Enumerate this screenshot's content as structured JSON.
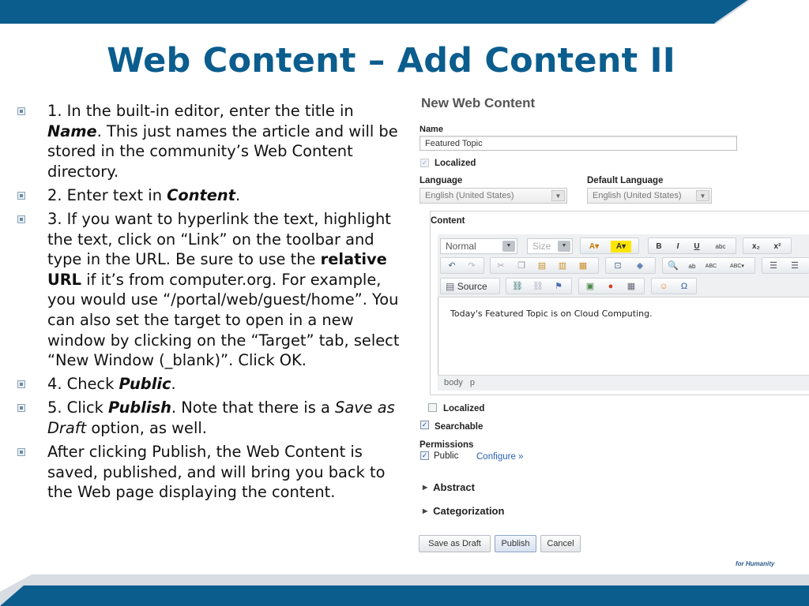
{
  "slide": {
    "title": "Web Content – Add Content II",
    "bullets": [
      {
        "runs": [
          {
            "t": "1. In the built-in editor, enter the title in "
          },
          {
            "t": "Name",
            "s": "bi"
          },
          {
            "t": ". This just names the article and will be stored in the community’s Web Content directory."
          }
        ]
      },
      {
        "runs": [
          {
            "t": "2. Enter text in "
          },
          {
            "t": "Content",
            "s": "bi"
          },
          {
            "t": "."
          }
        ]
      },
      {
        "runs": [
          {
            "t": "3. If you want to hyperlink the text, highlight the text, click on “Link” on the toolbar and type in the URL. Be sure to use the "
          },
          {
            "t": "relative URL",
            "s": "b"
          },
          {
            "t": " if it’s from computer.org. For example, you would use “/portal/web/guest/home”. You can also set the target to open in a new window by clicking on the “Target” tab, select “New Window (_blank)”. Click OK."
          }
        ]
      },
      {
        "runs": [
          {
            "t": "4. Check "
          },
          {
            "t": "Public",
            "s": "bi"
          },
          {
            "t": "."
          }
        ]
      },
      {
        "runs": [
          {
            "t": "5. Click "
          },
          {
            "t": "Publish",
            "s": "bi"
          },
          {
            "t": ". Note that there is a "
          },
          {
            "t": "Save as Draft",
            "s": "i"
          },
          {
            "t": " option, as well."
          }
        ]
      },
      {
        "runs": [
          {
            "t": "After clicking Publish, the Web Content is saved, published, and will bring you back to the Web page displaying the content."
          }
        ]
      }
    ]
  },
  "form": {
    "heading": "New Web Content",
    "name_label": "Name",
    "name_value": "Featured Topic",
    "localized_label": "Localized",
    "language_label": "Language",
    "language_value": "English (United States)",
    "default_language_label": "Default Language",
    "default_language_value": "English (United States)",
    "content_label": "Content",
    "toolbar": {
      "format_value": "Normal",
      "size_placeholder": "Size",
      "source_label": "Source",
      "bold": "B",
      "italic": "I",
      "underline": "U",
      "strike": "abc",
      "subscript": "x₂",
      "superscript": "x²"
    },
    "editor_text": "Today's Featured Topic is on Cloud Computing.",
    "status_path": "body p",
    "localized2_label": "Localized",
    "searchable_label": "Searchable",
    "permissions_label": "Permissions",
    "public_label": "Public",
    "configure_link": "Configure »",
    "abstract_label": "Abstract",
    "categorization_label": "Categorization",
    "buttons": {
      "save_draft": "Save as Draft",
      "publish": "Publish",
      "cancel": "Cancel"
    },
    "footer_logo": "for Humanity"
  },
  "colors": {
    "title": "#0b5d8e",
    "band": "#0b5d8e",
    "link": "#2a62b8"
  }
}
